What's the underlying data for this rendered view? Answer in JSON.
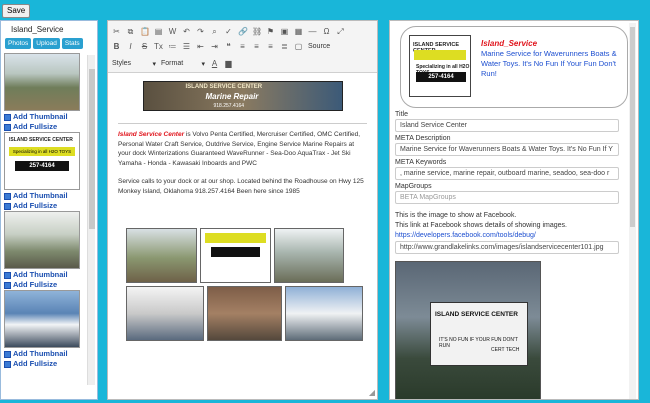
{
  "toolbar": {
    "save_label": "Save"
  },
  "left": {
    "title": "Island_Service",
    "tabs": [
      "Photos",
      "Upload",
      "Stats"
    ],
    "items": [
      {
        "thumb": "Add Thumbnail",
        "full": "Add Fullsize"
      },
      {
        "thumb": "Add Thumbnail",
        "full": "Add Fullsize"
      },
      {
        "thumb": "Add Thumbnail",
        "full": "Add Fullsize"
      },
      {
        "thumb": "Add Thumbnail",
        "full": "Add Fullsize"
      }
    ]
  },
  "editor": {
    "styles_label": "Styles",
    "format_label": "Format",
    "source_label": "Source",
    "banner": {
      "line1": "ISLAND SERVICE CENTER",
      "line2": "Marine Repair",
      "line3": "918.257.4164"
    },
    "para_lead": "Island Service Center",
    "para_body": " is Volvo Penta Certified, Mercruiser Certified, OMC Certified, Personal Water Craft Service, Outdrive Service, Engine Service Marine Repairs at your dock Winterizations Guaranteed WaveRunner - Sea-Doo AquaTrax - Jet Ski Yamaha - Honda - Kawasaki Inboards and PWC",
    "para2": "Service calls to your dock or at our shop. Located behind the Roadhouse on Hwy 125 Monkey Island, Oklahoma 918.257.4164 Been here since 1985"
  },
  "right": {
    "card_name": "Island_Service",
    "card_desc": "Marine Service for Waverunners Boats & Water Toys. It's No Fun If Your Fun Don't Run!",
    "logo_l1": "ISLAND SERVICE CENTER",
    "logo_l3": "Specializing in all H2O TOYS",
    "logo_l4": "257-4164",
    "title_label": "Title",
    "title_value": "Island Service Center",
    "meta_desc_label": "META Description",
    "meta_desc_value": "Marine Service for Waverunners Boats & Water Toys. It's No Fun If Y",
    "meta_kw_label": "META Keywords",
    "meta_kw_value": ", marine service, marine repair, outboard marine, seadoo, sea-doo r",
    "mapgroups_label": "MapGroups",
    "mapgroups_placeholder": "BETA MapGroups",
    "fb_line1": "This is the image to show at Facebook.",
    "fb_line2": "This link at Facebook shows details of showing images.",
    "fb_link": "https://developers.facebook.com/tools/debug/",
    "fb_url": "http://www.grandlakelinks.com/images/islandservicecenter101.jpg",
    "fb_sign_title": "ISLAND SERVICE CENTER",
    "fb_sign_slogan": "IT'S NO FUN IF YOUR FUN DON'T RUN",
    "fb_sign_tag": "CERT TECH"
  }
}
